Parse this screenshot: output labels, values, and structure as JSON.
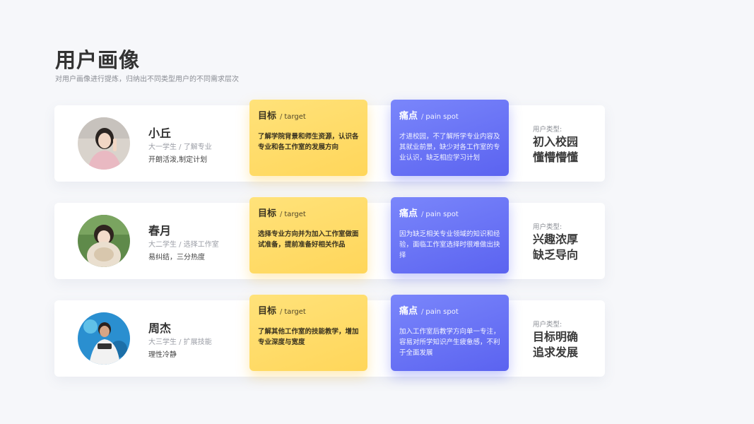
{
  "header": {
    "title": "用户画像",
    "subtitle": "对用户画像进行提炼，归纳出不同类型用户的不同需求层次"
  },
  "common": {
    "goal_label": "目标",
    "goal_sep": "/",
    "goal_en": "target",
    "pain_label": "痛点",
    "pain_sep": "/",
    "pain_en": "pain spot",
    "type_label": "用户类型:"
  },
  "users": [
    {
      "name": "小丘",
      "grade": "大一学生 / 了解专业",
      "trait": "开朗活泼,制定计划",
      "goal": "了解学院背景和师生资源，认识各专业和各工作室的发展方向",
      "pain": "才进校园，不了解所学专业内容及其就业前景，缺少对各工作室的专业认识，缺乏相应学习计划",
      "type_line1": "初入校园",
      "type_line2": "懂懵懵懂"
    },
    {
      "name": "春月",
      "grade": "大二学生 / 选择工作室",
      "trait": "易纠结，三分热度",
      "goal": "选择专业方向并为加入工作室做面试准备，提前准备好相关作品",
      "pain": "因为缺乏相关专业领域的知识和经验，面临工作室选择时很难做出抉择",
      "type_line1": "兴趣浓厚",
      "type_line2": "缺乏导向"
    },
    {
      "name": "周杰",
      "grade": "大三学生 / 扩展技能",
      "trait": "理性冷静",
      "goal": "了解其他工作室的技能教学，增加专业深度与宽度",
      "pain": "加入工作室后教学方向单一专注，容易对所学知识产生疲惫感，不利于全面发展",
      "type_line1": "目标明确",
      "type_line2": "追求发展"
    }
  ],
  "colors": {
    "goal_card": "#ffd65a",
    "pain_card": "#5b63f0",
    "background": "#f6f7fa"
  }
}
